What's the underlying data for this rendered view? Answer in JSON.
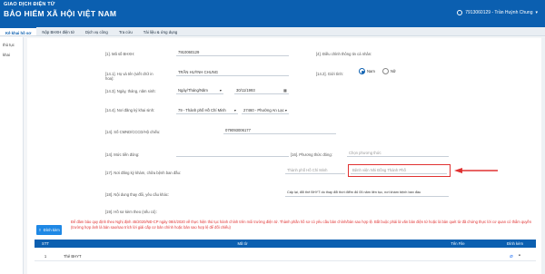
{
  "header": {
    "brand_top": "GIAO DỊCH ĐIỆN TỬ",
    "brand_main": "BẢO HIỂM XÃ HỘI VIỆT NAM",
    "user": "7913060129 - Trần Huỳnh Chung"
  },
  "nav": [
    "Kê khai hồ sơ",
    "Nộp BHXH điện tử",
    "Dịch vụ công",
    "Tra cứu",
    "Tài liệu & ứng dụng"
  ],
  "sidebar": [
    "thủ tục",
    "khai"
  ],
  "form": {
    "row1": {
      "label": "[1]. Mã số BHXH:",
      "value": "7910060129",
      "label2": "[4]. Điều chỉnh thông tin cá nhân:"
    },
    "row2": {
      "label": "[14.1]. Họ và tên (viết chữ in hoa):",
      "value": "TRẦN HUỲNH CHUNG",
      "label2": "[14.2]. Giới tính:",
      "opt1": "Nam",
      "opt2": "Nữ"
    },
    "row3": {
      "label": "[14.3]. Ngày, tháng, năm sinh:",
      "format": "Ngày/Tháng/Năm",
      "value": "30/11/1993"
    },
    "row4": {
      "label": "[14.4]. Nơi đăng ký khai sinh:",
      "province": "79 - Thành phố Hồ Chí Minh",
      "ward": "27460 - Phường An Lạc"
    },
    "row5": {
      "label": "[14]. Số CMND/CCCD/Hộ chiếu:",
      "value": "079093006177"
    },
    "row6": {
      "label": "[14]. Mức tiền đóng:",
      "label2": "[16]. Phương thức đóng:",
      "placeholder2": "Chọn phương thức"
    },
    "row7": {
      "label": "[17]. Nơi đăng ký khám, chữa bệnh ban đầu:",
      "province": "Thành phố Hồ Chí Minh",
      "hospital": "Bệnh viện Nhi Đồng Thành Phố"
    },
    "row8": {
      "label": "[18]. Nội dung thay đổi, yêu cầu khác:",
      "value": "Cấp lại, đổi thẻ BHYT do thay đổi thời điểm đủ 05 năm liên tục, nơi khám bệnh ban đầu"
    },
    "row9": {
      "label": "[19]. Hồ sơ kèm theo (nếu có):"
    }
  },
  "upload": {
    "label": "Đính kèm"
  },
  "warning": "Để đảm bảo quy định theo Nghị định 45/2020/NĐ-CP ngày 08/4/2020 về thực hiện thủ tục hành chính trên môi trường điện tử. Thành phần hồ sơ có yêu cầu bản chính/bản sao hợp lệ. Bắt buộc phải là văn bản điện tử hoặc là bản quét từ đã chứng thực lời cơ quan có thẩm quyền (trường hợp ảnh là bản sao/sao trích lời giải cấp cơ bản chính hoặc bản sao hợp lệ để đối chiếu)",
  "table": {
    "headers": [
      "STT",
      "Mã tờ",
      "Tên File",
      "Đính kèm"
    ],
    "rows": [
      {
        "stt": "1",
        "name": "Thẻ BHYT"
      }
    ]
  },
  "colors": {
    "primary": "#0b5fb0",
    "accent": "#1e88e5",
    "highlight": "#e03131"
  }
}
